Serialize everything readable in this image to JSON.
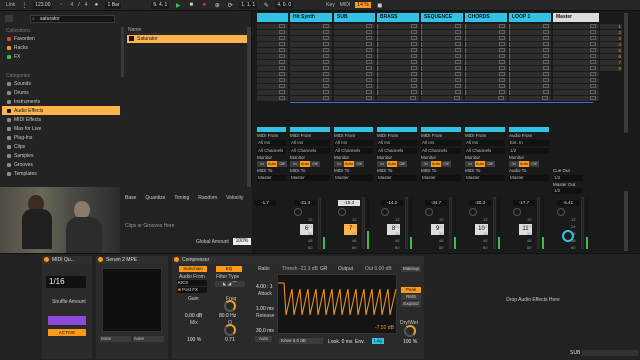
{
  "topbar": {
    "link": "Link",
    "tempo": "123.00",
    "sig_num": "4",
    "sig_den": "4",
    "quant": "1 Bar",
    "pos": "6. 4. 1",
    "pos2": "1. 1. 1",
    "pos3": "4. 0. 0",
    "key": "Key",
    "midi": "MIDI",
    "cpu": "14 %"
  },
  "browser": {
    "search_value": "saturator",
    "collections_label": "Collections",
    "collections": [
      {
        "label": "Favoriten",
        "color": "#e04040"
      },
      {
        "label": "Racks",
        "color": "#ff9a18"
      },
      {
        "label": "FX",
        "color": "#39c24a"
      }
    ],
    "categories_label": "Categories",
    "categories": [
      "Sounds",
      "Drums",
      "Instruments",
      "Audio Effects",
      "MIDI Effects",
      "Max for Live",
      "Plug-Ins",
      "Clips",
      "Samples",
      "Grooves",
      "Templates"
    ],
    "name_header": "Name",
    "result": "Saturator"
  },
  "groove": {
    "cols": [
      "Base",
      "Quantize",
      "Timing",
      "Random",
      "Velocity"
    ],
    "drop_hint": "Clips or Grooves Here",
    "global_label": "Global Amount",
    "global_value": "100%"
  },
  "session": {
    "tracks": [
      {
        "name": "",
        "color": "#33c2e6"
      },
      {
        "name": "Hit Synth",
        "color": "#33c2e6"
      },
      {
        "name": "SUB",
        "color": "#33c2e6"
      },
      {
        "name": "BRASS",
        "color": "#33c2e6"
      },
      {
        "name": "SEQUENCE",
        "color": "#33c2e6"
      },
      {
        "name": "CHORDS",
        "color": "#33c2e6"
      },
      {
        "name": "LOOP 1",
        "color": "#33c2e6"
      },
      {
        "name": "Master",
        "color": "#dcdcdc"
      }
    ],
    "scene_numbers": [
      "1",
      "2",
      "3",
      "4",
      "5",
      "6",
      "7",
      "8"
    ],
    "io": {
      "midi_from": "MIDI From",
      "audio_from": "Audio From",
      "all_ins": "All Ins",
      "ext_in": "Ext. In",
      "all_channels": "All Channels",
      "one_two": "1/2",
      "monitor": "Monitor",
      "in": "In",
      "auto": "Auto",
      "off": "Off",
      "midi_to": "MIDI To",
      "audio_to": "Audio To",
      "master": "Master",
      "cue_out": "Cue Out",
      "cue_val": "1/2",
      "master_out": "Master Out",
      "master_out_val": "1/2"
    },
    "volumes": [
      "-21.3",
      "-18.3",
      "-14.2",
      "-34.7",
      "-20.3",
      "-17.7",
      "-5.41"
    ],
    "track_numbers": [
      "6",
      "7",
      "8",
      "9",
      "10",
      "11"
    ],
    "scale_marks": [
      "12",
      "24",
      "36",
      "48",
      "60"
    ]
  },
  "devices": {
    "midi_device_title": "MIDI Qu...",
    "rate": "1/16",
    "shuffle_label": "Shuffle Amount",
    "active_label": "ACTIVE",
    "serum_title": "Serum 2 MPE",
    "none1": "none",
    "none2": "none",
    "comp_title": "Compressor",
    "sidechain_btn": "Sidechain",
    "eq_btn": "EQ",
    "audio_from_label": "Audio From",
    "audio_from_val": "KICK",
    "post_fx": "Post FX",
    "filter_type_label": "Filter Type",
    "gain_label": "Gain",
    "gain_val": "0.00 dB",
    "freq_label": "Freq",
    "freq_val": "80.0 Hz",
    "mix_label": "Mix",
    "mix_val": "100 %",
    "q_label": "Q",
    "q_val": "0.71",
    "ratio_label": "Ratio",
    "ratio_val": "4.00 : 1",
    "attack_label": "Attack",
    "attack_val": "1.00 ms",
    "release_label": "Release",
    "release_val": "30.0 ms",
    "auto_label": "Auto",
    "threshold": "Thresh -22.3 dB",
    "gr_label": "GR",
    "output_label": "Output",
    "out_val": "Out  0.00 dB",
    "gr_readout": "-7.52 dB",
    "knee": "Knee  6.0 dB",
    "look": "Look.  0 ms",
    "env": "Env.",
    "log": "Log",
    "makeup": "Makeup",
    "peak": "Peak",
    "rms": "RMS",
    "expand": "Expand",
    "drywet_label": "Dry/Wet",
    "drywet_val": "100 %",
    "drop_text": "Drop Audio Effects Here",
    "status_right": "SUB"
  }
}
